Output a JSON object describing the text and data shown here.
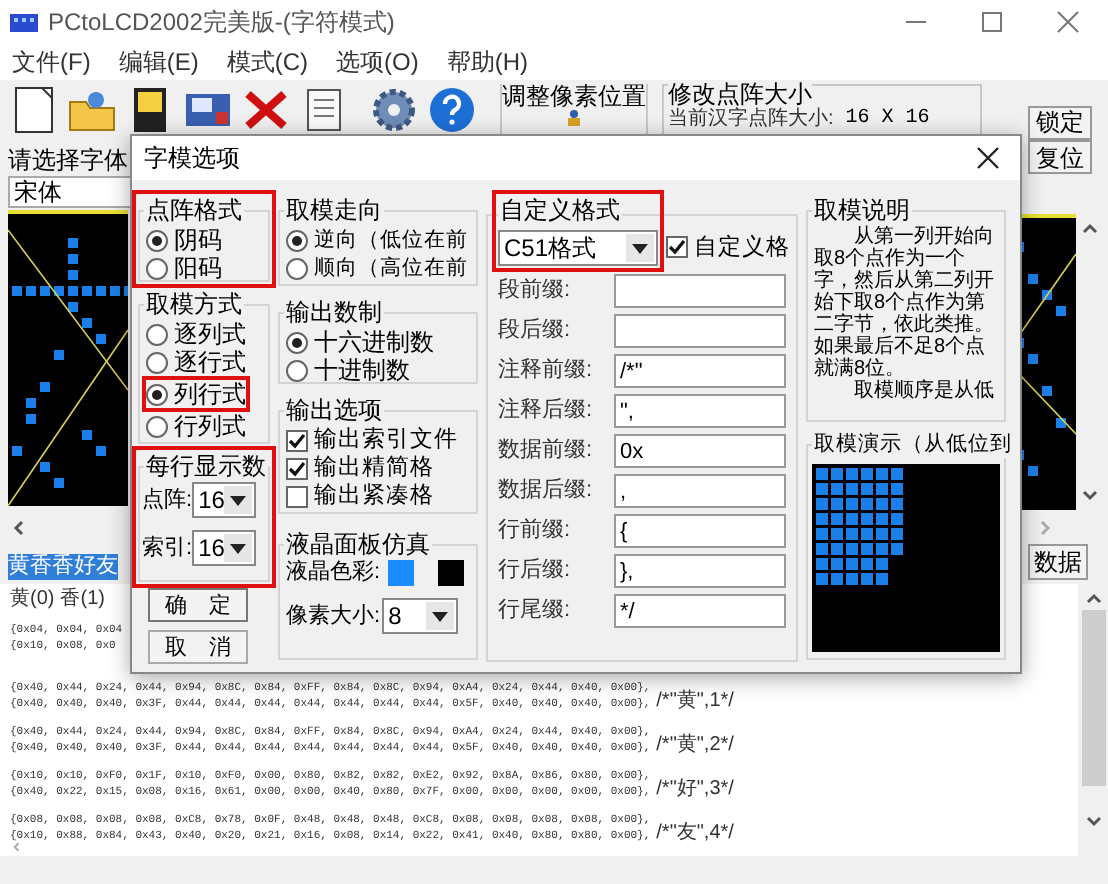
{
  "window": {
    "title": "PCtoLCD2002完美版-(字符模式)"
  },
  "menu": [
    "文件(F)",
    "编辑(E)",
    "模式(C)",
    "选项(O)",
    "帮助(H)"
  ],
  "toolbar": {
    "adjust_pixel": "调整像素位置",
    "dot_size": {
      "title": "修改点阵大小",
      "label": "当前汉字点阵大小:",
      "value": "16 X 16"
    },
    "lock_button": "锁定"
  },
  "reset_button": "复位",
  "font": {
    "label": "请选择字体",
    "value": "宋体"
  },
  "input_text": {
    "value": "黄香香好友",
    "selected": true
  },
  "clear_button": "数据",
  "char_tabs": [
    "黄(0)",
    "香(1)"
  ],
  "output": [
    {
      "lines": [
        {
          "data": "{0x04, 0x04, 0x04"
        },
        {
          "data": "{0x10, 0x08, 0x0"
        }
      ]
    },
    {
      "lines": [
        {
          "data": "{0x40, 0x44, 0x24, 0x44, 0x94, 0x8C, 0x84, 0xFF, 0x84, 0x8C, 0x94, 0xA4, 0x24, 0x44, 0x40, 0x00},"
        },
        {
          "data": "{0x40, 0x40, 0x40, 0x3F, 0x44, 0x44, 0x44, 0x44, 0x44, 0x44, 0x44, 0x5F, 0x40, 0x40, 0x40, 0x00},",
          "comment": "/*\"黄\",1*/"
        }
      ]
    },
    {
      "lines": [
        {
          "data": "{0x40, 0x44, 0x24, 0x44, 0x94, 0x8C, 0x84, 0xFF, 0x84, 0x8C, 0x94, 0xA4, 0x24, 0x44, 0x40, 0x00},"
        },
        {
          "data": "{0x40, 0x40, 0x40, 0x3F, 0x44, 0x44, 0x44, 0x44, 0x44, 0x44, 0x44, 0x5F, 0x40, 0x40, 0x40, 0x00},",
          "comment": "/*\"黄\",2*/"
        }
      ]
    },
    {
      "lines": [
        {
          "data": "{0x10, 0x10, 0xF0, 0x1F, 0x10, 0xF0, 0x00, 0x80, 0x82, 0x82, 0xE2, 0x92, 0x8A, 0x86, 0x80, 0x00},"
        },
        {
          "data": "{0x40, 0x22, 0x15, 0x08, 0x16, 0x61, 0x00, 0x00, 0x40, 0x80, 0x7F, 0x00, 0x00, 0x00, 0x00, 0x00},",
          "comment": "/*\"好\",3*/"
        }
      ]
    },
    {
      "lines": [
        {
          "data": "{0x08, 0x08, 0x08, 0x08, 0xC8, 0x78, 0x0F, 0x48, 0x48, 0x48, 0xC8, 0x08, 0x08, 0x08, 0x08, 0x00},"
        },
        {
          "data": "{0x10, 0x88, 0x84, 0x43, 0x40, 0x20, 0x21, 0x16, 0x08, 0x14, 0x22, 0x41, 0x40, 0x80, 0x80, 0x00},",
          "comment": "/*\"友\",4*/"
        }
      ]
    }
  ],
  "dialog": {
    "title": "字模选项",
    "dot_format": {
      "title": "点阵格式",
      "highlighted": true,
      "options": [
        {
          "label": "阴码",
          "selected": true
        },
        {
          "label": "阳码",
          "selected": false
        }
      ]
    },
    "scan_mode": {
      "title": "取模方式",
      "options": [
        {
          "label": "逐列式",
          "selected": false,
          "highlighted": false
        },
        {
          "label": "逐行式",
          "selected": false,
          "highlighted": false
        },
        {
          "label": "列行式",
          "selected": true,
          "highlighted": true
        },
        {
          "label": "行列式",
          "selected": false,
          "highlighted": false
        }
      ]
    },
    "per_line": {
      "title": "每行显示数",
      "highlighted": true,
      "fields": [
        {
          "label": "点阵:",
          "value": "16"
        },
        {
          "label": "索引:",
          "value": "16"
        }
      ]
    },
    "ok_button": "确　定",
    "cancel_button": "取　消",
    "direction": {
      "title": "取模走向",
      "options": [
        {
          "label": "逆向（低位在前",
          "selected": true
        },
        {
          "label": "顺向（高位在前",
          "selected": false
        }
      ]
    },
    "radix": {
      "title": "输出数制",
      "options": [
        {
          "label": "十六进制数",
          "selected": true
        },
        {
          "label": "十进制数",
          "selected": false
        }
      ]
    },
    "output_options": {
      "title": "输出选项",
      "options": [
        {
          "label": "输出索引文件",
          "checked": true
        },
        {
          "label": "输出精简格",
          "checked": true
        },
        {
          "label": "输出紧凑格",
          "checked": false
        }
      ]
    },
    "lcd": {
      "title": "液晶面板仿真",
      "color_label": "液晶色彩:",
      "colors": [
        {
          "color": "#1a8cff"
        },
        {
          "color": "#000000"
        }
      ],
      "pixel_label": "像素大小:",
      "pixel_size": "8"
    },
    "custom_format": {
      "title": "自定义格式",
      "highlighted": true,
      "preset": "C51格式",
      "custom": {
        "label": "自定义格",
        "checked": true
      },
      "fields": [
        {
          "label": "段前缀:"
        },
        {
          "label": "段后缀:"
        },
        {
          "label": "注释前缀:",
          "value": "/*\""
        },
        {
          "label": "注释后缀:",
          "value": "\","
        },
        {
          "label": "数据前缀:",
          "value": "0x"
        },
        {
          "label": "数据后缀:",
          "value": ","
        },
        {
          "label": "行前缀:",
          "value": "{"
        },
        {
          "label": "行后缀:",
          "value": "},"
        },
        {
          "label": "行尾缀:",
          "value": "*/"
        }
      ]
    },
    "description": {
      "title": "取模说明",
      "paragraphs": [
        "　　从第一列开始向取8个点作为一个字，然后从第二列开始下取8个点作为第二字节，依此类推。如果最后不足8个点就满8位。",
        "　　取模顺序是从低"
      ]
    },
    "preview": {
      "title": "取模演示（从低位到"
    }
  }
}
